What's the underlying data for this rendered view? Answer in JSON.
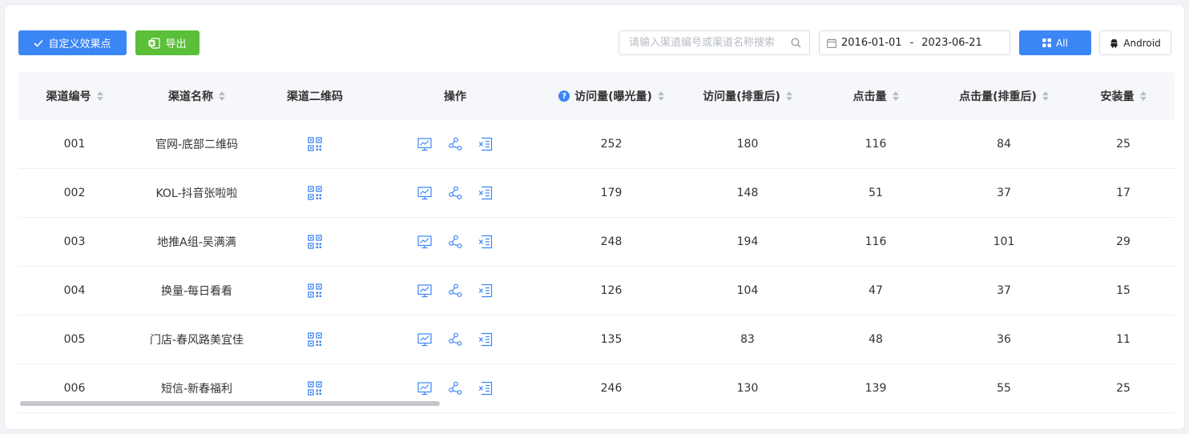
{
  "toolbar": {
    "custom_effect_label": "自定义效果点",
    "export_label": "导出",
    "search_placeholder": "请输入渠道编号或渠道名称搜索",
    "date_start": "2016-01-01",
    "date_separator": "-",
    "date_end": "2023-06-21",
    "all_label": "All",
    "android_label": "Android"
  },
  "table": {
    "headers": [
      "渠道编号",
      "渠道名称",
      "渠道二维码",
      "操作",
      "访问量(曝光量)",
      "访问量(排重后)",
      "点击量",
      "点击量(排重后)",
      "安装量"
    ],
    "rows": [
      {
        "id": "001",
        "name": "官网-底部二维码",
        "visits": "252",
        "visits_dedup": "180",
        "clicks": "116",
        "clicks_dedup": "84",
        "installs": "25"
      },
      {
        "id": "002",
        "name": "KOL-抖音张啦啦",
        "visits": "179",
        "visits_dedup": "148",
        "clicks": "51",
        "clicks_dedup": "37",
        "installs": "17"
      },
      {
        "id": "003",
        "name": "地推A组-吴满满",
        "visits": "248",
        "visits_dedup": "194",
        "clicks": "116",
        "clicks_dedup": "101",
        "installs": "29"
      },
      {
        "id": "004",
        "name": "换量-每日看看",
        "visits": "126",
        "visits_dedup": "104",
        "clicks": "47",
        "clicks_dedup": "37",
        "installs": "15"
      },
      {
        "id": "005",
        "name": "门店-春风路美宜佳",
        "visits": "135",
        "visits_dedup": "83",
        "clicks": "48",
        "clicks_dedup": "36",
        "installs": "11"
      },
      {
        "id": "006",
        "name": "短信-新春福利",
        "visits": "246",
        "visits_dedup": "130",
        "clicks": "139",
        "clicks_dedup": "55",
        "installs": "25"
      }
    ]
  },
  "icons": {
    "qr": "qr-code-icon",
    "chart": "chart-icon",
    "share": "share-icon",
    "delete": "delete-list-icon",
    "help": "help-icon"
  },
  "colors": {
    "primary": "#3b86f5",
    "success": "#5cbf3a"
  }
}
